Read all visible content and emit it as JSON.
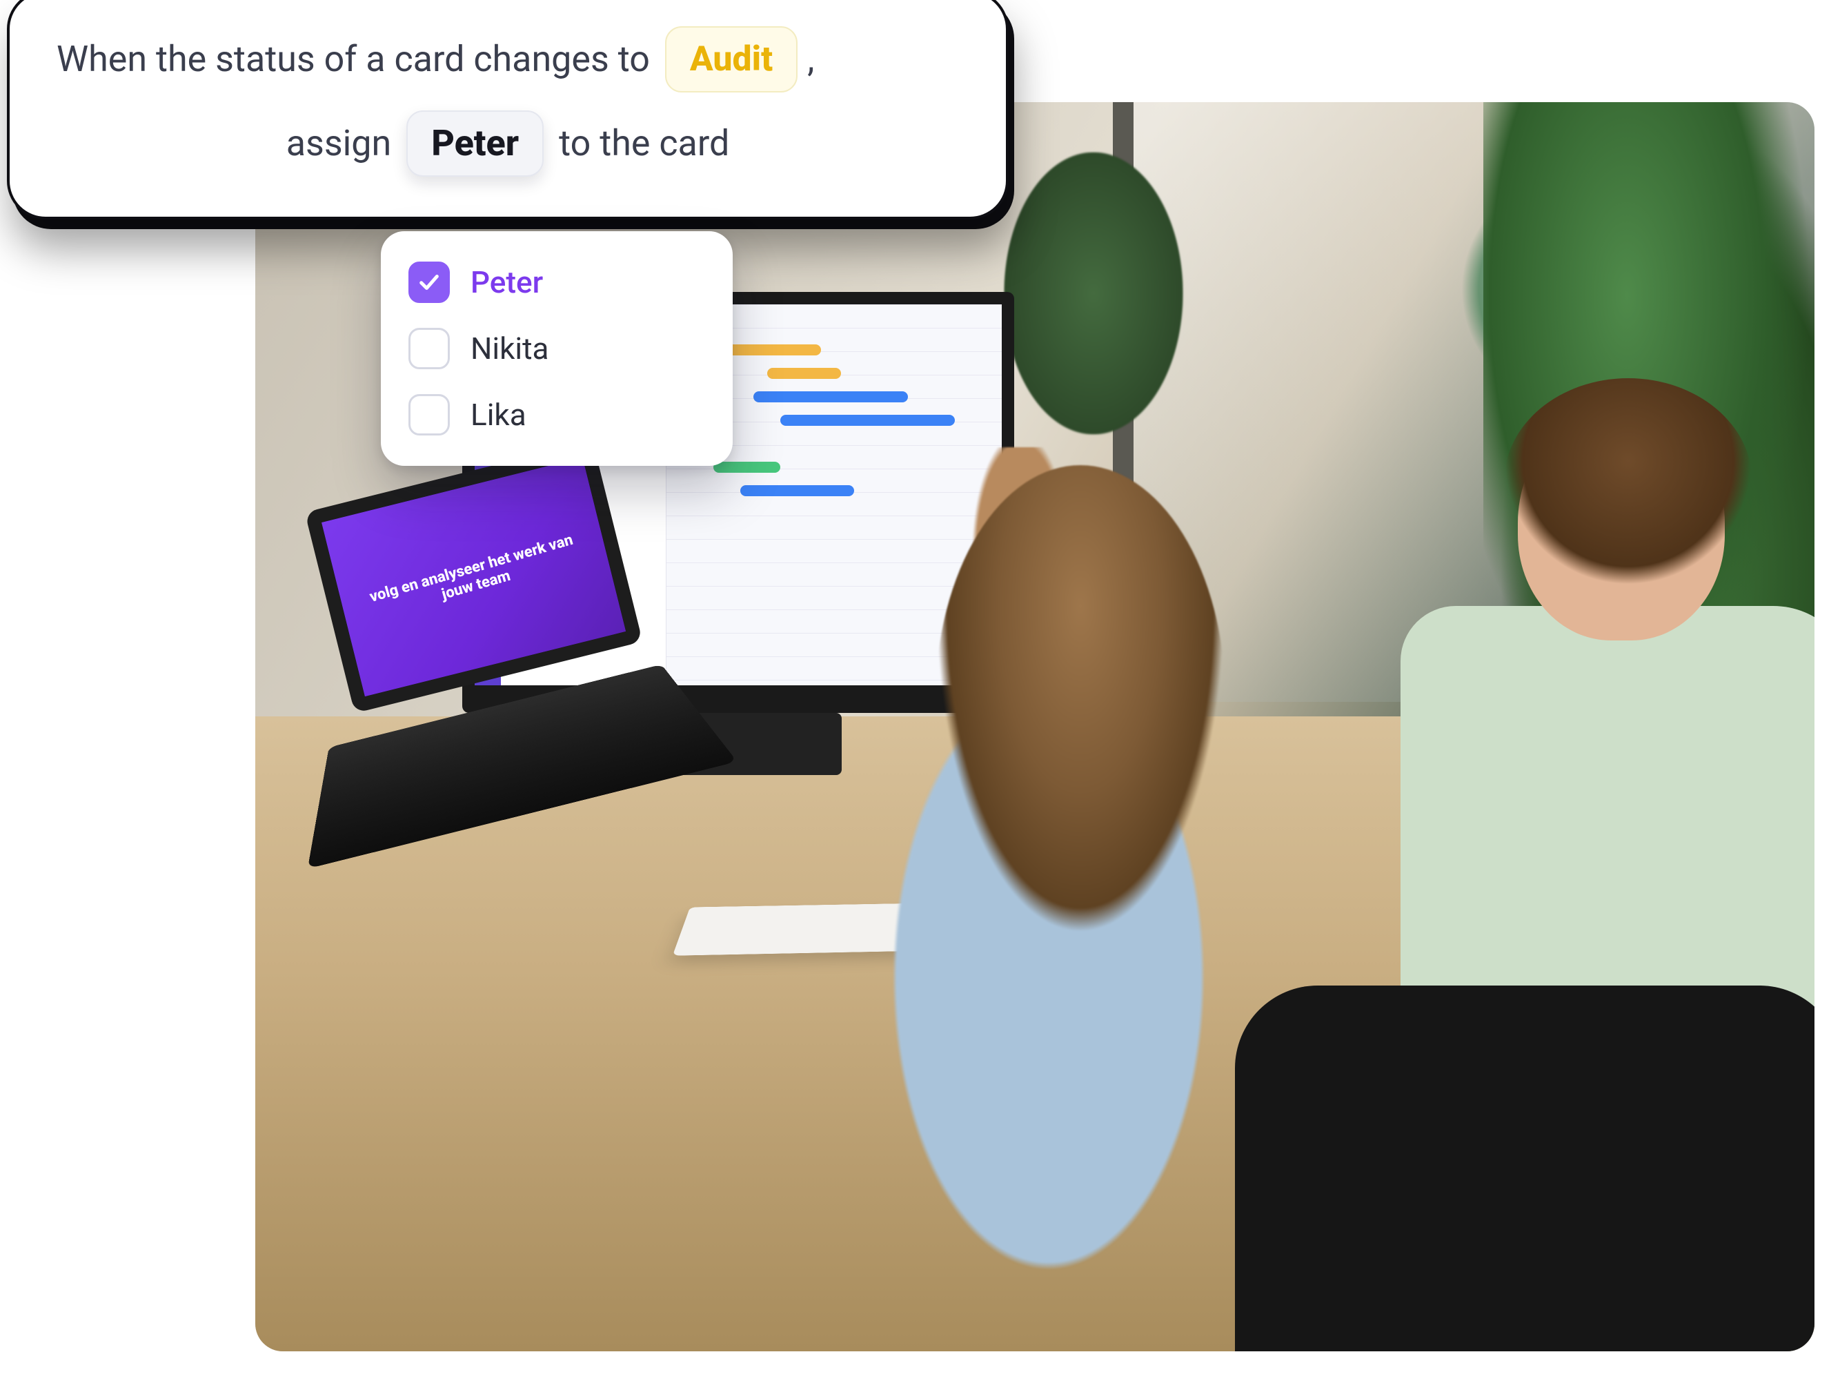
{
  "rule": {
    "prefix": "When the status of a card changes to",
    "status_value": "Audit",
    "comma": ",",
    "assign_prefix": "assign",
    "assignee_value": "Peter",
    "assign_suffix": "to the card"
  },
  "dropdown": {
    "options": [
      {
        "label": "Peter",
        "checked": true
      },
      {
        "label": "Nikita",
        "checked": false
      },
      {
        "label": "Lika",
        "checked": false
      }
    ]
  },
  "laptop": {
    "headline": "volg en analyseer het werk van jouw team"
  },
  "colors": {
    "accent_purple": "#8b5cf6",
    "status_yellow": "#eab308"
  }
}
